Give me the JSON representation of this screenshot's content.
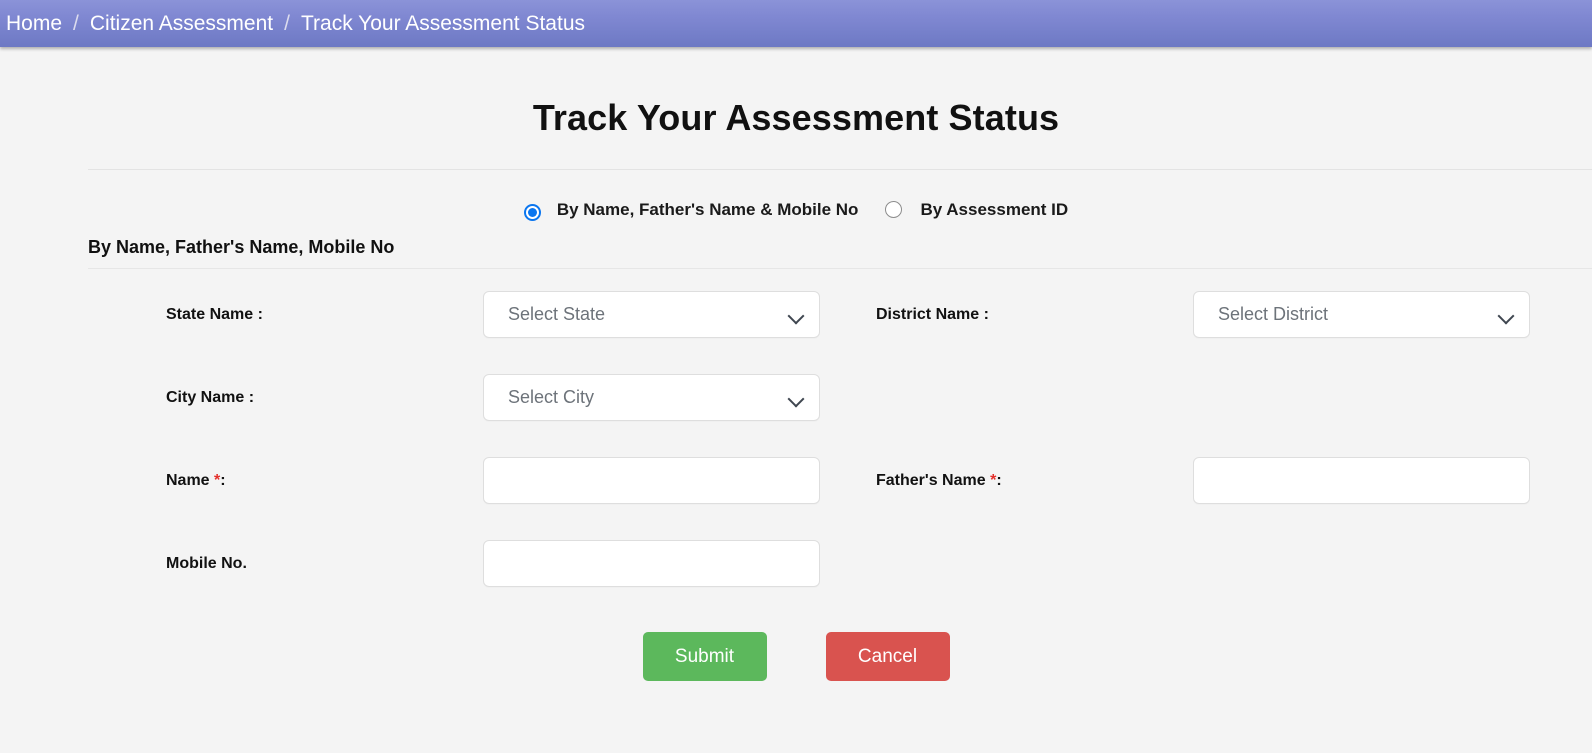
{
  "breadcrumb": {
    "separator": "/",
    "items": [
      {
        "label": "Home"
      },
      {
        "label": "Citizen Assessment"
      },
      {
        "label": "Track Your Assessment Status"
      }
    ]
  },
  "page": {
    "title": "Track Your Assessment Status"
  },
  "search_mode": {
    "options": [
      {
        "label": "By Name, Father's Name & Mobile No",
        "selected": true
      },
      {
        "label": "By Assessment ID",
        "selected": false
      }
    ]
  },
  "section": {
    "heading": "By Name, Father's Name, Mobile No"
  },
  "form": {
    "state": {
      "label": "State Name :",
      "placeholder": "Select State",
      "value": "Select State",
      "required": false
    },
    "district": {
      "label": "District Name :",
      "placeholder": "Select District",
      "value": "Select District",
      "required": false
    },
    "city": {
      "label": "City Name :",
      "placeholder": "Select City",
      "value": "Select City",
      "required": false
    },
    "name": {
      "label": "Name ",
      "required_mark": "*",
      "label_suffix": ":",
      "value": "",
      "placeholder": ""
    },
    "father_name": {
      "label": "Father's Name ",
      "required_mark": "*",
      "label_suffix": ":",
      "value": "",
      "placeholder": ""
    },
    "mobile": {
      "label": "Mobile No.",
      "value": "",
      "placeholder": ""
    }
  },
  "actions": {
    "submit_label": "Submit",
    "cancel_label": "Cancel"
  },
  "colors": {
    "breadcrumb_top": "#8b93d8",
    "breadcrumb_bottom": "#6d79c4",
    "page_background": "#f4f4f4",
    "radio_accent": "#0b76ef",
    "required_asterisk": "#e4302b",
    "submit_green": "#5cb85c",
    "cancel_red": "#d9534f"
  }
}
